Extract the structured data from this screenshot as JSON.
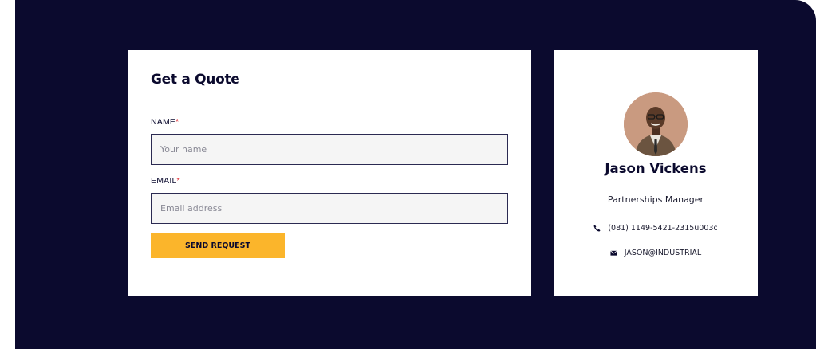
{
  "form": {
    "title": "Get a Quote",
    "name_label": "NAME",
    "name_placeholder": "Your name",
    "email_label": "EMAIL",
    "email_placeholder": "Email address",
    "required_mark": "*",
    "submit_label": "SEND REQUEST"
  },
  "profile": {
    "name": "Jason Vickens",
    "role": "Partnerships Manager",
    "phone": "(081) 1149-5421-2315u003c",
    "email": "JASON@INDUSTRIAL",
    "phone_icon": "phone-icon",
    "email_icon": "envelope-icon"
  },
  "colors": {
    "background": "#0b0a2e",
    "accent": "#fbb52b",
    "required": "#e0262d"
  }
}
